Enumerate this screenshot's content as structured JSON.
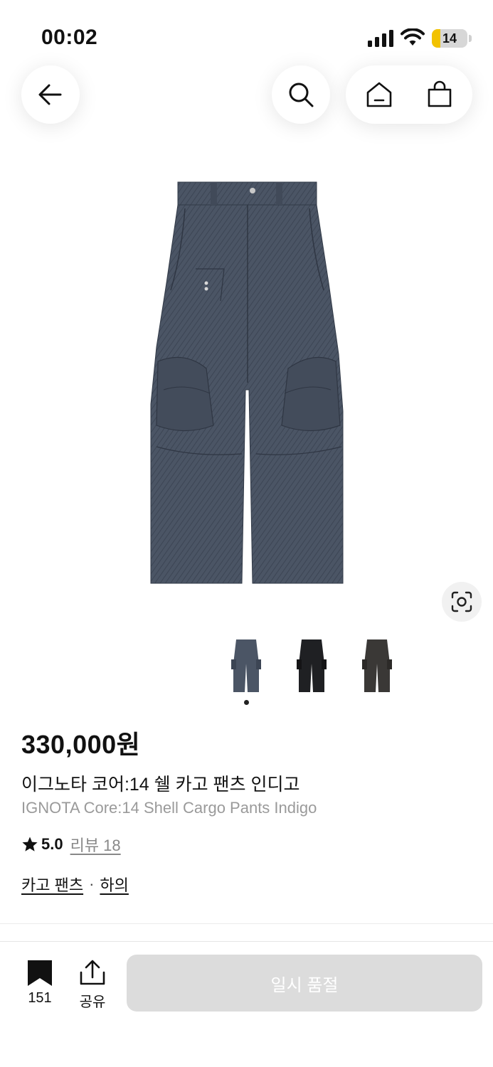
{
  "status_bar": {
    "time": "00:02",
    "battery_level": "14",
    "icons": [
      "cellular-signal-icon",
      "wifi-icon",
      "battery-icon"
    ]
  },
  "nav": {
    "icons": [
      "arrow-left-icon",
      "search-icon",
      "home-icon",
      "shopping-bag-icon"
    ]
  },
  "product": {
    "image_icon": "indigo-denim-cargo-pants-image",
    "lens_icon": "visual-search-icon",
    "thumbnails": [
      "indigo-pants-thumbnail",
      "black-pants-thumbnail",
      "charcoal-pants-thumbnail"
    ],
    "selected_thumbnail_index": 0,
    "price": "330,000원",
    "title_ko": "이그노타 코어:14 쉘 카고 팬츠 인디고",
    "title_en": "IGNOTA Core:14 Shell Cargo Pants Indigo",
    "rating": "5.0",
    "review_label": "리뷰 18",
    "categories": [
      "카고 팬츠",
      "하의"
    ],
    "category_separator": "·"
  },
  "bottom_bar": {
    "bookmark_count": "151",
    "share_label": "공유",
    "cta_label": "일시 품절"
  },
  "colors": {
    "denim": "#4b5565",
    "battery_fill": "#f2c200",
    "cta_disabled_bg": "#dcdcdc"
  }
}
